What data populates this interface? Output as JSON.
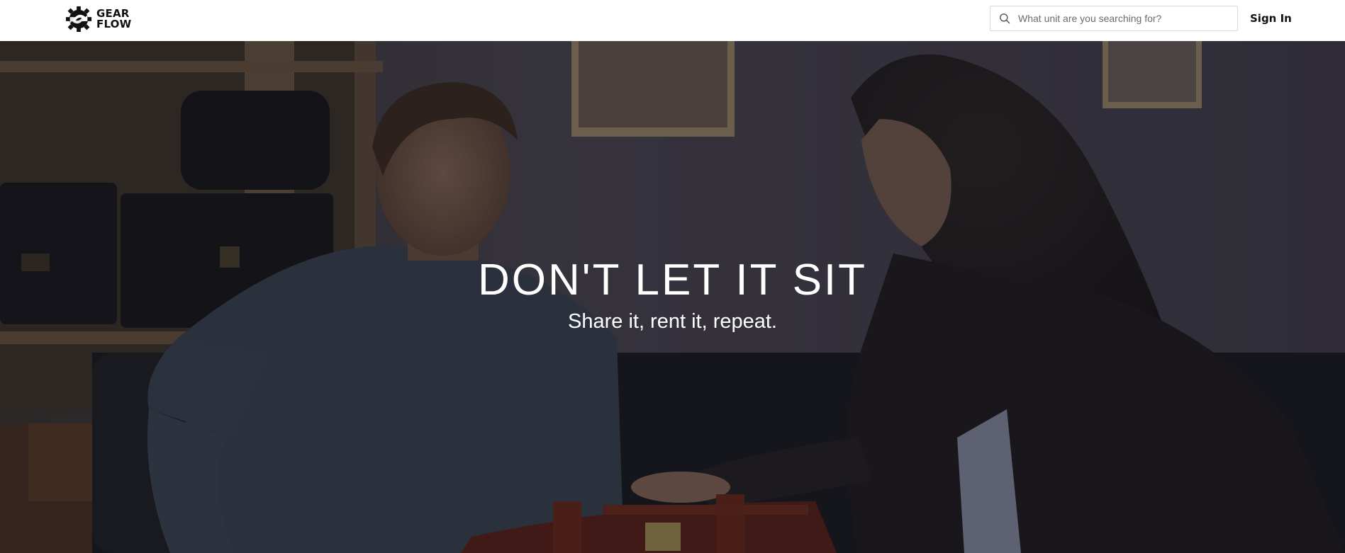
{
  "brand": {
    "logo_icon": "gear-arrow-icon",
    "line1": "GEAR",
    "line2": "FLOW"
  },
  "search": {
    "placeholder": "What unit are you searching for?",
    "value": "",
    "icon": "search-icon"
  },
  "nav": {
    "signin_label": "Sign In"
  },
  "hero": {
    "title": "DON'T LET IT SIT",
    "subtitle": "Share it, rent it, repeat."
  },
  "colors": {
    "header_bg": "#ffffff",
    "text_dark": "#111111",
    "hero_text": "#ffffff"
  }
}
